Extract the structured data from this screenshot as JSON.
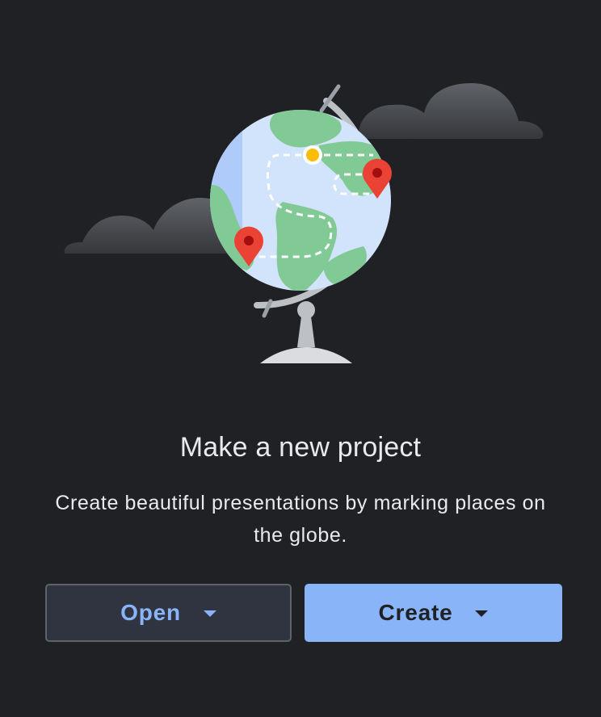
{
  "empty_state": {
    "title": "Make a new project",
    "description": "Create beautiful presentations by marking places on the globe."
  },
  "actions": {
    "open_label": "Open",
    "create_label": "Create"
  },
  "icons": {
    "illustration": "globe-icon",
    "pin": "map-pin-icon",
    "dropdown": "caret-down-icon"
  },
  "colors": {
    "background": "#202124",
    "primary": "#8ab4f8",
    "text": "#e8eaed",
    "land": "#81c995",
    "ocean": "#d2e3fc",
    "pin": "#ea4335",
    "waypoint": "#fbbc04"
  }
}
